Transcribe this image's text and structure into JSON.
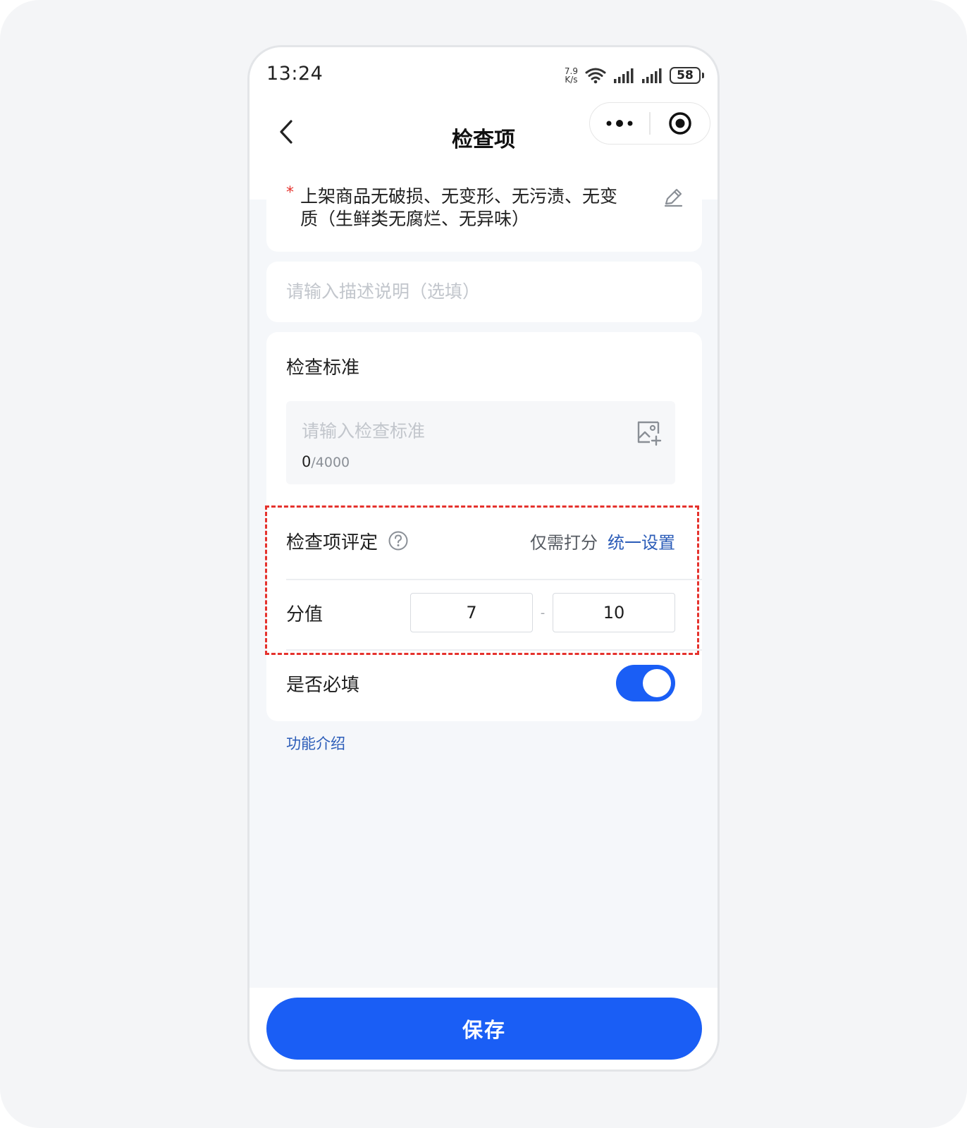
{
  "status_bar": {
    "time": "13:24",
    "net_speed_value": "7.9",
    "net_speed_unit": "K/s",
    "battery": "58"
  },
  "nav": {
    "title": "检查项"
  },
  "item": {
    "required_mark": "*",
    "name": "上架商品无破损、无变形、无污渍、无变质（生鲜类无腐烂、无异味）",
    "description_placeholder": "请输入描述说明（选填）",
    "description_value": ""
  },
  "standard": {
    "title": "检查标准",
    "placeholder": "请输入检查标准",
    "count": "0",
    "max": "/4000"
  },
  "rating": {
    "label": "检查项评定",
    "mode": "仅需打分",
    "unify_link": "统一设置",
    "score_label": "分值",
    "score_min": "7",
    "score_sep": "-",
    "score_max": "10"
  },
  "required": {
    "label": "是否必填",
    "enabled": true
  },
  "links": {
    "intro": "功能介绍"
  },
  "footer": {
    "save_label": "保存"
  },
  "colors": {
    "primary": "#1a5ef5",
    "link": "#2b5cb8",
    "required_star": "#e5322d",
    "highlight_dashes": "#e5322d"
  }
}
